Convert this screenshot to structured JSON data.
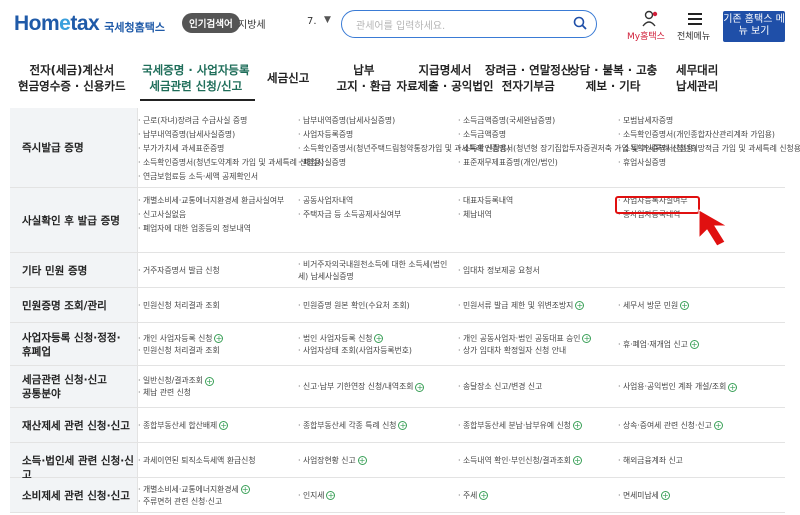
{
  "header": {
    "logo_main_a": "Hom",
    "logo_main_e": "e",
    "logo_main_b": "tax",
    "logo_kr": "국세청홈택스",
    "popular_label": "인기검색어",
    "popular_keyword": "지방세",
    "popular_rank": "7.",
    "search_placeholder": "관세어를 입력하세요.",
    "my_label": "My홈택스",
    "menu_label": "전체메뉴",
    "classic_button": "기존 홈택스 메뉴 보기"
  },
  "nav": [
    {
      "lines": [
        "전자(세금)계산서",
        "현금영수증 · 신용카드"
      ]
    },
    {
      "lines": [
        "국세증명 · 사업자등록",
        "세금관련 신청/신고"
      ],
      "active": true
    },
    {
      "lines": [
        "세금신고"
      ]
    },
    {
      "lines": [
        "납부",
        "고지 · 환급"
      ]
    },
    {
      "lines": [
        "지급명세서",
        "자료제출 · 공익법인"
      ]
    },
    {
      "lines": [
        "장려금 · 연말정산",
        "전자기부금"
      ]
    },
    {
      "lines": [
        "상담 · 불복 · 고충",
        "제보 · 기타"
      ]
    },
    {
      "lines": [
        "세무대리",
        "납세관리"
      ]
    }
  ],
  "rows": [
    {
      "title": [
        "즉시발급 증명"
      ],
      "cells": [
        [
          "· 근로(자녀)장려금 수급사실 증명",
          "· 납부내역증명(납세사실증명)",
          "· 부가가치세 과세표준증명",
          "· 소득확인증명서(청년도약계좌 가입 및 과세특례 신청용)",
          "· 연금보험료등 소득·세액 공제확인서"
        ],
        [
          "· 납부내역증명(납세사실증명)",
          "· 사업자등록증명",
          "· 소득확인증명서(청년주택드림청약통장가입 및 과세특례 신청용)",
          "· 폐업사실증명"
        ],
        [
          "· 소득금액증명(국세완납증명)",
          "· 소득금액증명",
          "· 소득확인증명서(청년형 장기집합투자증권저축 가입 및 과세특례 신청용)",
          "· 표준재무제표증명(개인/법인)"
        ],
        [
          "· 모범납세자증명",
          "· 소득확인증명서(개인종합자산관리계좌 가입용)",
          "· 소득확인증명서(청년희망적금 가입 및 과세특례 신청용)",
          "· 휴업사실증명"
        ]
      ]
    },
    {
      "title": [
        "사실확인 후 발급 증명"
      ],
      "cells": [
        [
          "· 개별소비세·교통에너지환경세 환급사실여부",
          "· 신고사실없음",
          "· 폐업자에 대한 업종등의 정보내역"
        ],
        [
          "· 공동사업자내역",
          "· 주택자금 등 소득공제사실여부"
        ],
        [
          "· 대표자등록내역",
          "· 체납내역"
        ],
        [
          "· 사업자등록사실여부",
          "· 종사업자등록내역"
        ]
      ]
    },
    {
      "title": [
        "기타 민원 증명"
      ],
      "cells": [
        [
          "· 거주자증명서 발급 신청"
        ],
        [
          "· 비거주자의국내원천소득에 대한 소득세(법인",
          "세) 납세사실증명"
        ],
        [
          "· 임대차 정보제공 요청서"
        ],
        []
      ]
    },
    {
      "title": [
        "민원증명 조회/관리"
      ],
      "cells": [
        [
          "· 민원신청 처리결과 조회"
        ],
        [
          "· 민원증명 원본 확인(수요처 조회)"
        ],
        [
          "· 민원서류 발급 제한 및 위변조방지"
        ],
        [
          "· 세무서 방문 민원"
        ]
      ]
    },
    {
      "title": [
        "사업자등록 신청·정정·",
        "휴폐업"
      ],
      "cells": [
        [
          "· 개인 사업자등록 신청",
          "· 민원신청 처리결과 조회"
        ],
        [
          "· 법인 사업자등록 신청",
          "· 사업자상태 조회(사업자등록번호)"
        ],
        [
          "· 개인 공동사업자·법인 공동대표 승인",
          "· 상가 임대차 확정일자 신청 안내"
        ],
        [
          "· 휴·폐업·재개업 신고"
        ]
      ]
    },
    {
      "title": [
        "세금관련 신청·신고",
        "공통분야"
      ],
      "cells": [
        [
          "· 일반신청/결과조회",
          "· 체납 관련 신청"
        ],
        [
          "· 신고·납부 기한연장 신청/내역조회"
        ],
        [
          "· 송달장소 신고/변경 신고"
        ],
        [
          "· 사업용·공익법인 계좌 개설/조회"
        ]
      ]
    },
    {
      "title": [
        "재산제세 관련 신청·신고"
      ],
      "cells": [
        [
          "· 종합부동산세 합산배제"
        ],
        [
          "· 종합부동산세 각종 특례 신청"
        ],
        [
          "· 종합부동산세 분납·납부유예 신청"
        ],
        [
          "· 상속·증여세 관련 신청·신고"
        ]
      ]
    },
    {
      "title": [
        "소득·법인세 관련 신청·신고"
      ],
      "cells": [
        [
          "· 과세이연된 퇴직소득세액 환급신청"
        ],
        [
          "· 사업장현황 신고"
        ],
        [
          "· 소득내역 확인·부인신청/결과조회"
        ],
        [
          "· 해외금융계좌 신고"
        ]
      ]
    },
    {
      "title": [
        "소비제세 관련 신청·신고"
      ],
      "cells": [
        [
          "· 개별소비세·교통에너지환경세",
          "· 주류면허 관련 신청·신고"
        ],
        [
          "· 인지세"
        ],
        [
          "· 주세"
        ],
        [
          "· 면세미납세"
        ]
      ]
    }
  ],
  "highlight_target": "· 사업자등록사실여부"
}
